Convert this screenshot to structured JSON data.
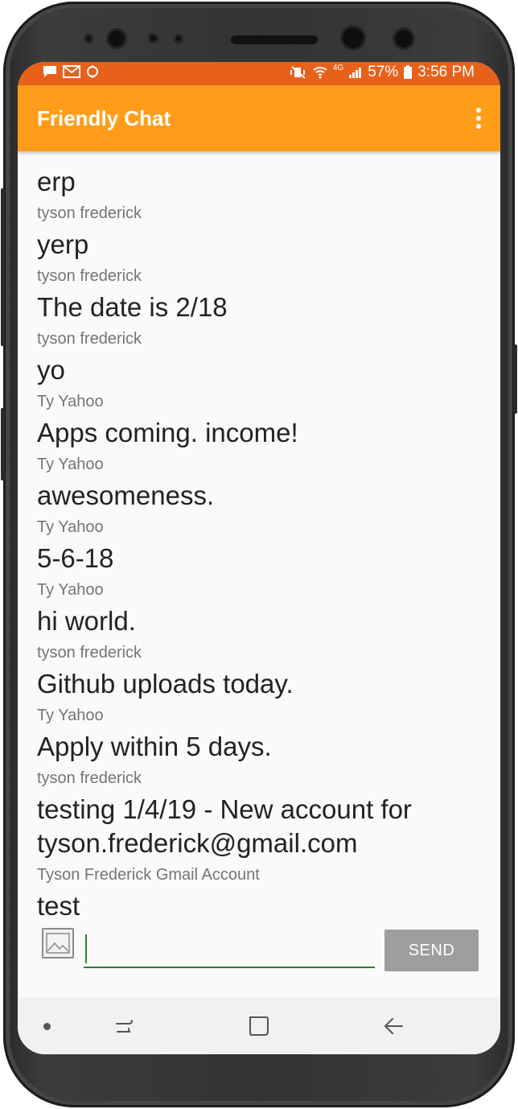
{
  "status_bar": {
    "notification_icons": [
      "chat-bubble-icon",
      "gmail-icon",
      "android-wear-icon"
    ],
    "system_icons": [
      "vibrate-mute-icon",
      "wifi-icon",
      "lte-4g-icon",
      "signal-icon",
      "battery-icon"
    ],
    "network": "4G",
    "battery": "57%",
    "time": "3:56 PM",
    "color": "#e8611a"
  },
  "toolbar": {
    "title": "Friendly Chat",
    "color": "#ff9d1b",
    "menu_icon": "overflow-menu-icon"
  },
  "messages": [
    {
      "text": "erp",
      "name": "tyson frederick"
    },
    {
      "text": "yerp",
      "name": "tyson frederick"
    },
    {
      "text": "The date is 2/18",
      "name": "tyson frederick"
    },
    {
      "text": "yo",
      "name": "Ty Yahoo"
    },
    {
      "text": "Apps coming. income!",
      "name": "Ty Yahoo"
    },
    {
      "text": "awesomeness.",
      "name": "Ty Yahoo"
    },
    {
      "text": "5-6-18",
      "name": "Ty Yahoo"
    },
    {
      "text": "hi world.",
      "name": "tyson frederick"
    },
    {
      "text": "Github uploads today.",
      "name": "Ty Yahoo"
    },
    {
      "text": "Apply within 5 days.",
      "name": "tyson frederick"
    },
    {
      "text": "testing 1/4/19 - New account for tyson.frederick@gmail.com",
      "name": "Tyson Frederick Gmail Account"
    },
    {
      "text": "test",
      "name": ""
    }
  ],
  "composer": {
    "add_image_icon": "image-icon",
    "input_value": "",
    "send_label": "SEND",
    "send_color": "#9e9e9e",
    "underline_color": "#2e7d32"
  },
  "nav_bar": {
    "icons": [
      "nav-dot-icon",
      "recent-apps-icon",
      "home-icon",
      "back-icon"
    ]
  }
}
